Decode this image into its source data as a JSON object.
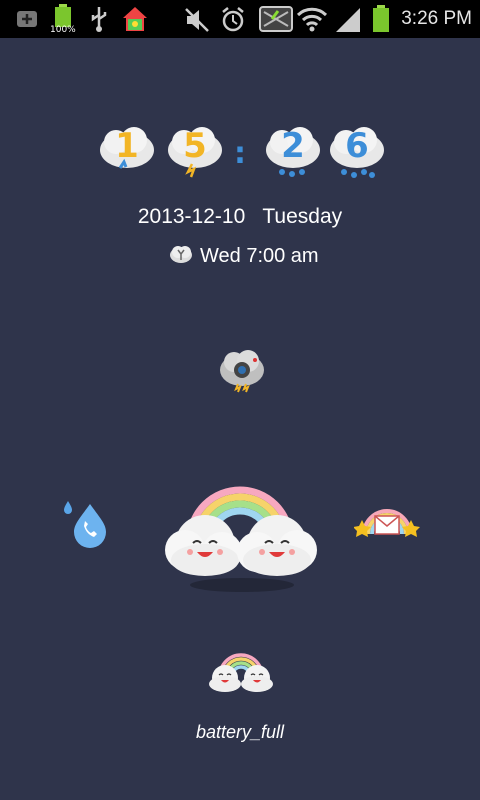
{
  "status_bar": {
    "time": "3:26 PM",
    "battery_percent_label": "100%",
    "icons": [
      "plus-icon",
      "battery-100-icon",
      "usb-icon",
      "home-app-icon",
      "mute-icon",
      "alarm-icon",
      "sim-icon",
      "wifi-icon",
      "signal-icon",
      "battery-icon"
    ]
  },
  "clock": {
    "digits": [
      "1",
      "5",
      "2",
      "6"
    ],
    "separator": ":"
  },
  "date_text": "2013-12-10   Tuesday",
  "alarm_text": "Wed 7:00 am",
  "label": "battery_full",
  "colors": {
    "background": "#2f344b",
    "digit_yellow": "#f2b526",
    "digit_blue": "#3d8ed8"
  }
}
